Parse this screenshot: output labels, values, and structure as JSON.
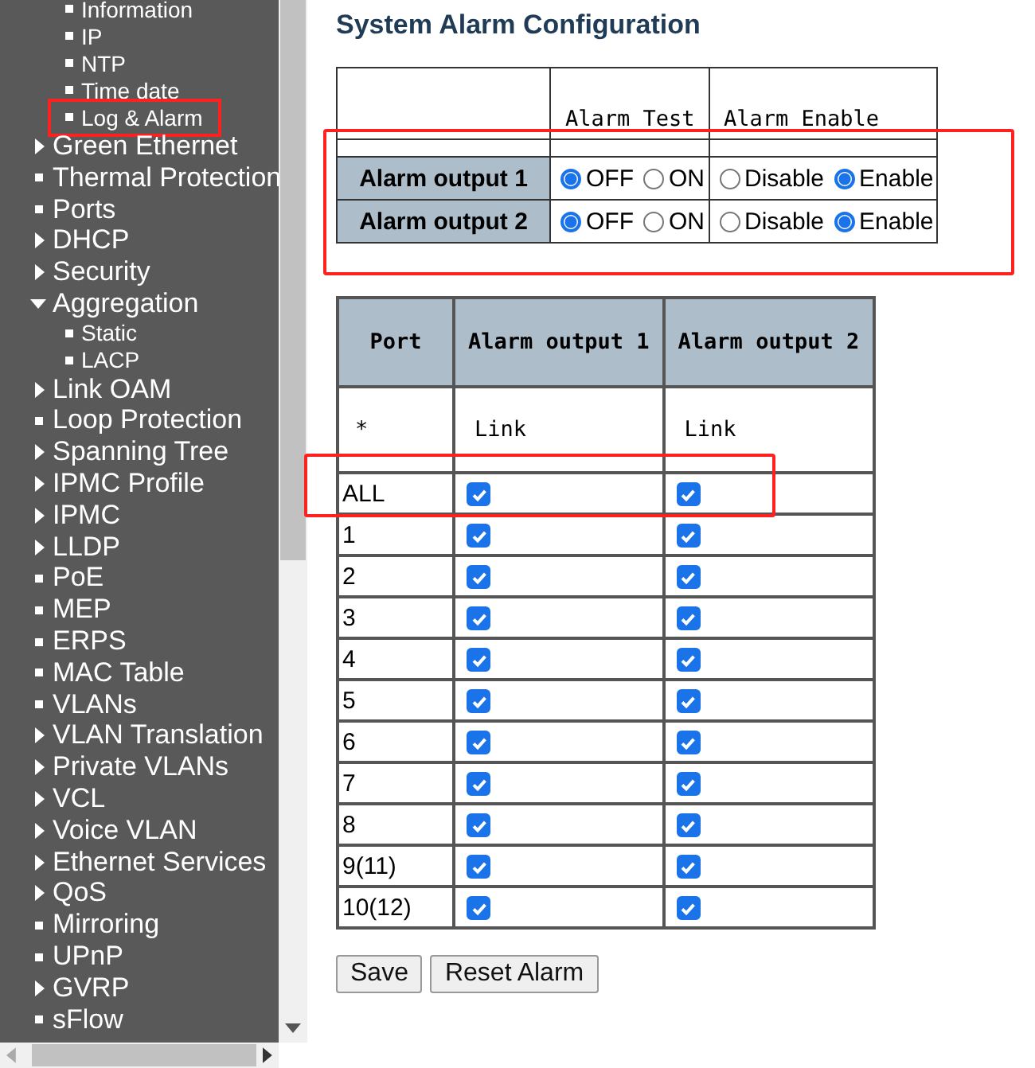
{
  "sidebar": {
    "items": [
      {
        "label": "Information",
        "kind": "subitem",
        "annotated": false
      },
      {
        "label": "IP",
        "kind": "subitem",
        "annotated": false
      },
      {
        "label": "NTP",
        "kind": "subitem",
        "annotated": false
      },
      {
        "label": "Time date",
        "kind": "subitem",
        "annotated": false
      },
      {
        "label": "Log & Alarm",
        "kind": "subitem",
        "annotated": true
      },
      {
        "label": "Green Ethernet",
        "kind": "collapsed"
      },
      {
        "label": "Thermal Protection",
        "kind": "leaf"
      },
      {
        "label": "Ports",
        "kind": "leaf"
      },
      {
        "label": "DHCP",
        "kind": "collapsed"
      },
      {
        "label": "Security",
        "kind": "collapsed"
      },
      {
        "label": "Aggregation",
        "kind": "expanded",
        "children": [
          {
            "label": "Static"
          },
          {
            "label": "LACP"
          }
        ]
      },
      {
        "label": "Link OAM",
        "kind": "collapsed"
      },
      {
        "label": "Loop Protection",
        "kind": "leaf"
      },
      {
        "label": "Spanning Tree",
        "kind": "collapsed"
      },
      {
        "label": "IPMC Profile",
        "kind": "collapsed"
      },
      {
        "label": "IPMC",
        "kind": "collapsed"
      },
      {
        "label": "LLDP",
        "kind": "collapsed"
      },
      {
        "label": "PoE",
        "kind": "leaf"
      },
      {
        "label": "MEP",
        "kind": "leaf"
      },
      {
        "label": "ERPS",
        "kind": "leaf"
      },
      {
        "label": "MAC Table",
        "kind": "leaf"
      },
      {
        "label": "VLANs",
        "kind": "leaf"
      },
      {
        "label": "VLAN Translation",
        "kind": "collapsed"
      },
      {
        "label": "Private VLANs",
        "kind": "collapsed"
      },
      {
        "label": "VCL",
        "kind": "collapsed"
      },
      {
        "label": "Voice VLAN",
        "kind": "collapsed"
      },
      {
        "label": "Ethernet Services",
        "kind": "collapsed"
      },
      {
        "label": "QoS",
        "kind": "collapsed"
      },
      {
        "label": "Mirroring",
        "kind": "leaf"
      },
      {
        "label": "UPnP",
        "kind": "leaf"
      },
      {
        "label": "GVRP",
        "kind": "collapsed"
      },
      {
        "label": "sFlow",
        "kind": "leaf"
      }
    ]
  },
  "title": "System Alarm Configuration",
  "alarm_config": {
    "annotated": true,
    "columns": [
      "Alarm Test",
      "Alarm Enable"
    ],
    "rows": [
      {
        "label": "Alarm output 1",
        "test": [
          {
            "label": "OFF",
            "selected": true
          },
          {
            "label": "ON",
            "selected": false
          }
        ],
        "enable": [
          {
            "label": "Disable",
            "selected": false
          },
          {
            "label": "Enable",
            "selected": true
          }
        ]
      },
      {
        "label": "Alarm output 2",
        "test": [
          {
            "label": "OFF",
            "selected": true
          },
          {
            "label": "ON",
            "selected": false
          }
        ],
        "enable": [
          {
            "label": "Disable",
            "selected": false
          },
          {
            "label": "Enable",
            "selected": true
          }
        ]
      }
    ]
  },
  "port_table": {
    "columns": [
      "Port",
      "Alarm output 1",
      "Alarm output 2"
    ],
    "subheader": [
      "*",
      "Link",
      "Link"
    ],
    "rows": [
      {
        "port": "ALL",
        "output_1": true,
        "output_2": true,
        "annotated": true
      },
      {
        "port": "1",
        "output_1": true,
        "output_2": true,
        "annotated": false
      },
      {
        "port": "2",
        "output_1": true,
        "output_2": true,
        "annotated": false
      },
      {
        "port": "3",
        "output_1": true,
        "output_2": true,
        "annotated": false
      },
      {
        "port": "4",
        "output_1": true,
        "output_2": true,
        "annotated": false
      },
      {
        "port": "5",
        "output_1": true,
        "output_2": true,
        "annotated": false
      },
      {
        "port": "6",
        "output_1": true,
        "output_2": true,
        "annotated": false
      },
      {
        "port": "7",
        "output_1": true,
        "output_2": true,
        "annotated": false
      },
      {
        "port": "8",
        "output_1": true,
        "output_2": true,
        "annotated": false
      },
      {
        "port": "9(11)",
        "output_1": true,
        "output_2": true,
        "annotated": false
      },
      {
        "port": "10(12)",
        "output_1": true,
        "output_2": true,
        "annotated": false
      }
    ]
  },
  "buttons": [
    "Save",
    "Reset Alarm"
  ]
}
